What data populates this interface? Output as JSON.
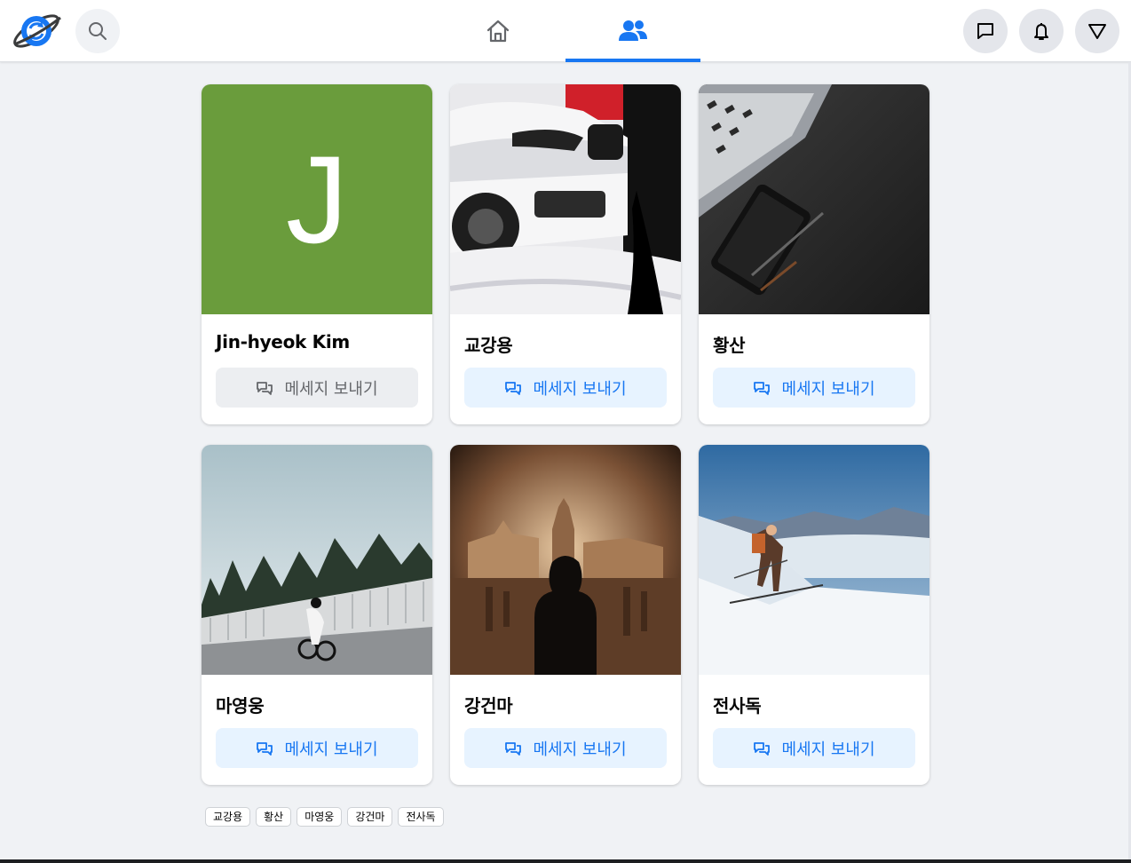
{
  "header": {
    "logo_icon": "planet-sync-logo",
    "search_icon": "search-icon",
    "nav": [
      {
        "name": "home",
        "icon": "home-icon",
        "active": false
      },
      {
        "name": "friends",
        "icon": "friends-icon",
        "active": true
      }
    ],
    "right_icons": [
      "messenger-icon",
      "bell-icon",
      "triangle-down-icon"
    ]
  },
  "colors": {
    "accent": "#1877f2",
    "accent_light": "#e7f3ff",
    "background": "#f0f2f5",
    "avatar_green": "#6a9c3c"
  },
  "friends": [
    {
      "name": "Jin-hyeok Kim",
      "button": "메세지 보내기",
      "photo": "letter-avatar",
      "avatar_letter": "J",
      "button_disabled": true
    },
    {
      "name": "교강용",
      "button": "메세지 보내기",
      "photo": "white-suv-snow-photo",
      "button_disabled": false
    },
    {
      "name": "황산",
      "button": "메세지 보내기",
      "photo": "laptop-phone-desk-photo",
      "button_disabled": false
    },
    {
      "name": "마영웅",
      "button": "메세지 보내기",
      "photo": "cyclist-bridge-photo",
      "button_disabled": false
    },
    {
      "name": "강건마",
      "button": "메세지 보내기",
      "photo": "hooded-man-old-town-photo",
      "button_disabled": false
    },
    {
      "name": "전사독",
      "button": "메세지 보내기",
      "photo": "skier-mountain-photo",
      "button_disabled": false
    }
  ],
  "chips": [
    "교강용",
    "황산",
    "마영웅",
    "강건마",
    "전사독"
  ]
}
